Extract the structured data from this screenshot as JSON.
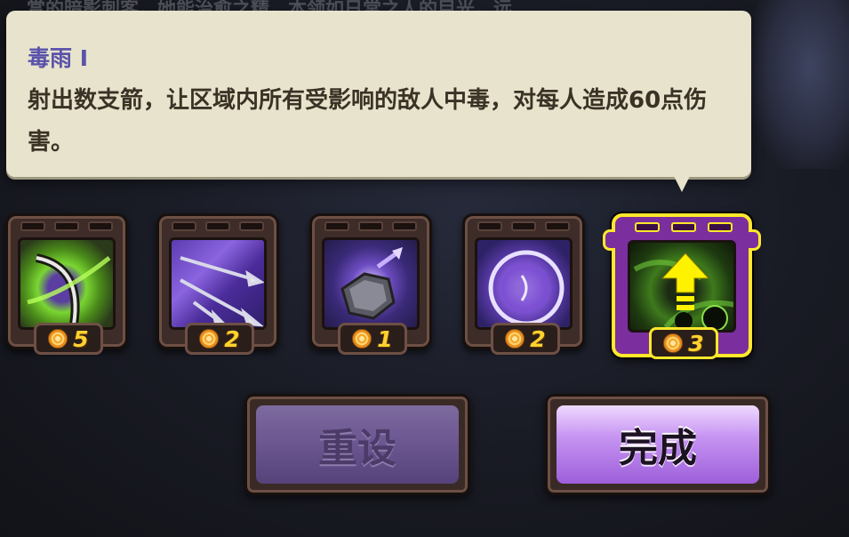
{
  "background": {
    "partial_text": "赏的暗影刺客，她能治愈之精，本领如日常之人的目光，远"
  },
  "tooltip": {
    "title": "毒雨 I",
    "description": "射出数支箭，让区域内所有受影响的敌人中毒，对每人造成60点伤害。"
  },
  "skills": [
    {
      "cost": "5",
      "icon": "green-slash-skill-icon"
    },
    {
      "cost": "2",
      "icon": "triple-arrow-skill-icon"
    },
    {
      "cost": "1",
      "icon": "arrow-shield-skill-icon"
    },
    {
      "cost": "2",
      "icon": "purple-orb-skill-icon"
    },
    {
      "cost": "3",
      "icon": "poison-rain-skill-icon",
      "selected": true,
      "upgrade": "up-arrow-icon"
    }
  ],
  "buttons": {
    "reset_label": "重设",
    "done_label": "完成"
  },
  "colors": {
    "tooltip_bg": "#e7e3cc",
    "title_color": "#5a53aa",
    "selected_border": "#ffe82b",
    "cost_color": "#ffd230"
  }
}
